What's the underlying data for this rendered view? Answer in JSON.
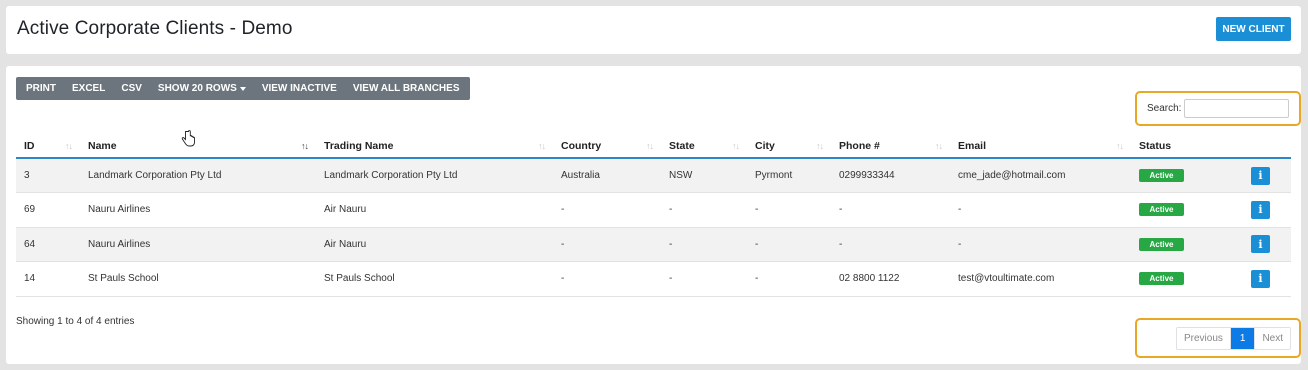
{
  "header": {
    "title": "Active Corporate Clients - Demo",
    "new_client_label": "NEW CLIENT"
  },
  "toolbar": {
    "buttons": [
      "PRINT",
      "EXCEL",
      "CSV",
      "SHOW 20 ROWS",
      "VIEW INACTIVE",
      "VIEW ALL BRANCHES"
    ]
  },
  "search": {
    "label": "Search:",
    "value": ""
  },
  "table": {
    "columns": [
      "ID",
      "Name",
      "Trading Name",
      "Country",
      "State",
      "City",
      "Phone #",
      "Email",
      "Status"
    ],
    "rows": [
      [
        "3",
        "Landmark Corporation Pty Ltd",
        "Landmark Corporation Pty Ltd",
        "Australia",
        "NSW",
        "Pyrmont",
        "0299933344",
        "cme_jade@hotmail.com",
        "Active"
      ],
      [
        "69",
        "Nauru Airlines",
        "Air Nauru",
        "-",
        "-",
        "-",
        "-",
        "-",
        "Active"
      ],
      [
        "64",
        "Nauru Airlines",
        "Air Nauru",
        "-",
        "-",
        "-",
        "-",
        "-",
        "Active"
      ],
      [
        "14",
        "St Pauls School",
        "St Pauls School",
        "-",
        "-",
        "-",
        "02 8800 1122",
        "test@vtoultimate.com",
        "Active"
      ]
    ],
    "info_icon": "info-icon"
  },
  "footer": {
    "entries_info": "Showing 1 to 4 of 4 entries",
    "pagination": {
      "previous": "Previous",
      "current": "1",
      "next": "Next"
    }
  },
  "colors": {
    "primary": "#1a8fd6",
    "toolbar": "#6c757d",
    "active_badge": "#28a745",
    "highlight_outline": "#e8a826"
  }
}
